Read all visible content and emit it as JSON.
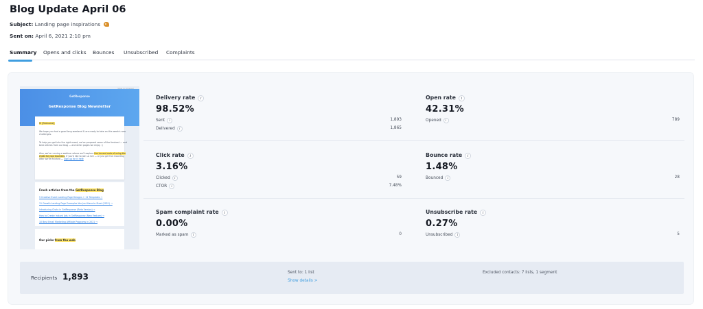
{
  "header": {
    "title": "Blog Update April 06",
    "subject_label": "Subject:",
    "subject_value": "Landing page inspirations",
    "sent_label": "Sent on:",
    "sent_value": "April 6, 2021 2:10 pm"
  },
  "tabs": [
    {
      "label": "Summary",
      "active": true
    },
    {
      "label": "Opens and clicks",
      "active": false
    },
    {
      "label": "Bounces",
      "active": false
    },
    {
      "label": "Unsubscribed",
      "active": false
    },
    {
      "label": "Complaints",
      "active": false
    }
  ],
  "preview": {
    "top_label": "View in browser",
    "brand": "GetResponse",
    "newsletter_title": "GetResponse Blog Newsletter",
    "greeting": "Hi [firstname],",
    "p1a": "We hope you had a good long weekend & are ready to take on this week's new",
    "p1b": "challenges.",
    "p2a": "To help you get into the right mood, we've prepared some of the freshest — and",
    "p2b": "best articles from our blog — and other pages we enjoy. :)",
    "p3a": "Also, we're running a webinar where we'll explore",
    "p3a_hl": "the ins and outs of using the",
    "p3b_hl": "chats for your business",
    "p3b": ". If you'd like to join us live — or just get the recording",
    "p3c": "after we're finished —",
    "p3c_link": "Sign up for it here",
    "fresh_head": "Fresh articles from the",
    "fresh_head_hl": "GetResponse Blog",
    "links": [
      "5 Creative Event Landing Page Designs + 11 Templates →",
      "11 Growth Landing Page Examples You Just Have to Steal (2021) →",
      "Introducing Chats in GetResponse (Beta Version) →",
      "How to Create Instant Ads in GetResponse (New Feature) →",
      "10 Best Email Marketing Affiliate Programs in 2021 →"
    ],
    "picks_head": "Our picks",
    "picks_head_hl": "from the web"
  },
  "metrics": [
    {
      "id": "delivery",
      "label": "Delivery rate",
      "value": "98.52%",
      "sub": [
        {
          "label": "Sent",
          "value": "1,893",
          "info": true
        },
        {
          "label": "Delivered",
          "value": "1,865",
          "info": true
        }
      ]
    },
    {
      "id": "open",
      "label": "Open rate",
      "value": "42.31%",
      "sub": [
        {
          "label": "Opened",
          "value": "789",
          "info": true
        }
      ]
    },
    {
      "id": "click",
      "label": "Click rate",
      "value": "3.16%",
      "sub": [
        {
          "label": "Clicked",
          "value": "59",
          "info": true
        },
        {
          "label": "CTOR",
          "value": "7.48%",
          "info": true
        }
      ]
    },
    {
      "id": "bounce",
      "label": "Bounce rate",
      "value": "1.48%",
      "sub": [
        {
          "label": "Bounced",
          "value": "28",
          "info": true
        }
      ]
    },
    {
      "id": "spam",
      "label": "Spam complaint rate",
      "value": "0.00%",
      "sub": [
        {
          "label": "Marked as spam",
          "value": "0",
          "info": true
        }
      ]
    },
    {
      "id": "unsub",
      "label": "Unsubscribe rate",
      "value": "0.27%",
      "sub": [
        {
          "label": "Unsubscribed",
          "value": "5",
          "info": true
        }
      ]
    }
  ],
  "recipients": {
    "label": "Recipients",
    "value": "1,893",
    "sent_to": "Sent to: 1 list",
    "show_details": "Show details >",
    "excluded": "Excluded contacts: 7 lists, 1 segment"
  },
  "colors": {
    "accent": "#3f9ee0",
    "highlight": "#ffe56a",
    "hero": "#4b8fe6"
  }
}
